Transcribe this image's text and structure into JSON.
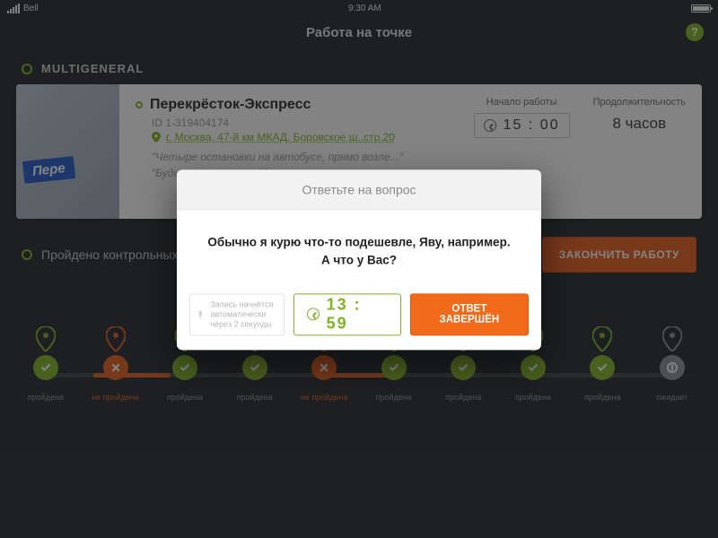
{
  "status": {
    "carrier": "Bell",
    "time": "9:30 AM"
  },
  "header": {
    "title": "Работа на точке"
  },
  "section": {
    "name": "MULTIGENERAL"
  },
  "venue": {
    "thumb_label": "Пере",
    "name": "Перекрёсток-Экспресс",
    "id": "ID 1-319404174",
    "address": "г. Москва, 47-й км МКАД, Боровское ш.,стр.20",
    "note1": "\"Четыре остановки на автобусе, прямо возле...\"",
    "note2": "\"Будьте аккуратны...\"",
    "start_label": "Начало работы",
    "start_time": "15 : 00",
    "duration_label": "Продолжительность",
    "duration": "8 часов"
  },
  "progress": {
    "label": "Пройдено контрольных точ",
    "end_button": "ЗАКОНЧИТЬ РАБОТУ"
  },
  "timeline": [
    {
      "status": "ok",
      "label": "пройдена"
    },
    {
      "status": "bad",
      "label": "не пройдена"
    },
    {
      "status": "ok",
      "label": "пройдена"
    },
    {
      "status": "ok",
      "label": "пройдена"
    },
    {
      "status": "bad",
      "label": "не пройдена"
    },
    {
      "status": "ok",
      "label": "пройдена"
    },
    {
      "status": "ok",
      "label": "пройдена"
    },
    {
      "status": "ok",
      "label": "пройдена"
    },
    {
      "status": "ok",
      "label": "пройдена"
    },
    {
      "status": "wait",
      "label": "ожидает"
    }
  ],
  "modal": {
    "title": "Ответьте на вопрос",
    "line1": "Обычно я курю что-то подешевле, Яву, например.",
    "line2": "А что у Вас?",
    "rec_hint": "Запись начнётся автоматически через 2 секунды",
    "timer": "13 : 59",
    "done": "ОТВЕТ ЗАВЕРШЁН"
  }
}
